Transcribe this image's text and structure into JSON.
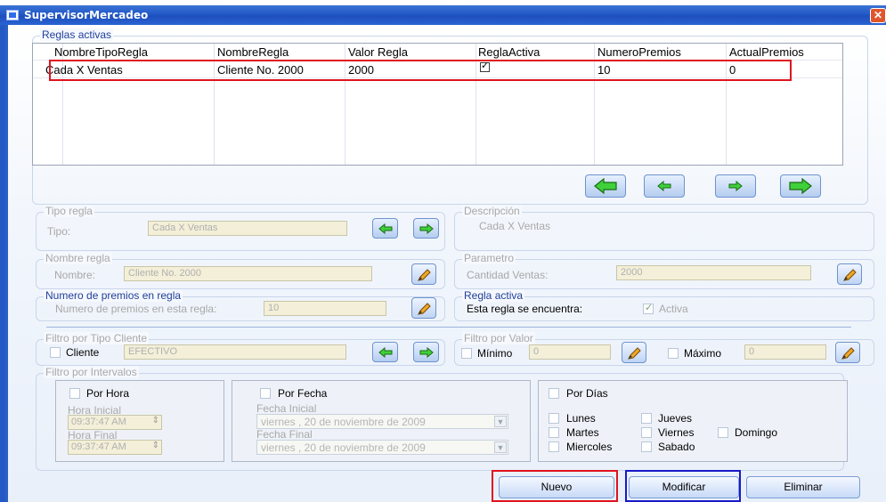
{
  "window": {
    "title": "SupervisorMercadeo",
    "close_label": "✕"
  },
  "reglas_activas": {
    "title": "Reglas activas",
    "columns": [
      "NombreTipoRegla",
      "NombreRegla",
      "Valor Regla",
      "ReglaActiva",
      "NumeroPremios",
      "ActualPremios"
    ],
    "rows": [
      {
        "tipo": "Cada X Ventas",
        "nombre": "Cliente No. 2000",
        "valor": "2000",
        "activa": true,
        "numero": "10",
        "actual": "0"
      }
    ]
  },
  "tipo_regla": {
    "title": "Tipo regla",
    "label": "Tipo:",
    "value": "Cada X Ventas"
  },
  "descripcion": {
    "title": "Descripción",
    "value": "Cada X Ventas"
  },
  "nombre_regla": {
    "title": "Nombre regla",
    "label": "Nombre:",
    "value": "Cliente No. 2000"
  },
  "parametro": {
    "title": "Parametro",
    "label": "Cantidad Ventas:",
    "value": "2000"
  },
  "numero_premios": {
    "title": "Numero de premios en regla",
    "label": "Numero de premios en esta regla:",
    "value": "10"
  },
  "regla_activa": {
    "title": "Regla activa",
    "label": "Esta regla se encuentra:",
    "check_label": "Activa",
    "checked": true
  },
  "filtro_tipo_cliente": {
    "title": "Filtro por Tipo Cliente",
    "check_label": "Cliente",
    "value": "EFECTIVO"
  },
  "filtro_valor": {
    "title": "Filtro por Valor",
    "min_label": "Mínimo",
    "min_value": "0",
    "max_label": "Máximo",
    "max_value": "0"
  },
  "filtro_intervalos": {
    "title": "Filtro por Intervalos",
    "por_hora": {
      "label": "Por Hora",
      "hora_inicial_label": "Hora Inicial",
      "hora_inicial": "09:37:47 AM",
      "hora_final_label": "Hora Final",
      "hora_final": "09:37:47 AM"
    },
    "por_fecha": {
      "label": "Por Fecha",
      "fecha_inicial_label": "Fecha Inicial",
      "fecha_inicial": "viernes  , 20 de noviembre de 2009",
      "fecha_final_label": "Fecha Final",
      "fecha_final": "viernes  , 20 de noviembre de 2009"
    },
    "por_dias": {
      "label": "Por Días",
      "days": [
        "Lunes",
        "Jueves",
        "Martes",
        "Viernes",
        "Domingo",
        "Miercoles",
        "Sabado"
      ]
    }
  },
  "actions": {
    "nuevo": "Nuevo",
    "modificar": "Modificar",
    "eliminar": "Eliminar"
  },
  "icons": {
    "nav_arrow": "green-arrow-icon",
    "edit": "pencil-icon"
  },
  "colors": {
    "title_bar": "#2259c7",
    "highlight_red": "#e0141e",
    "highlight_blue": "#1919c8",
    "arrow_green": "#3fd13a"
  }
}
